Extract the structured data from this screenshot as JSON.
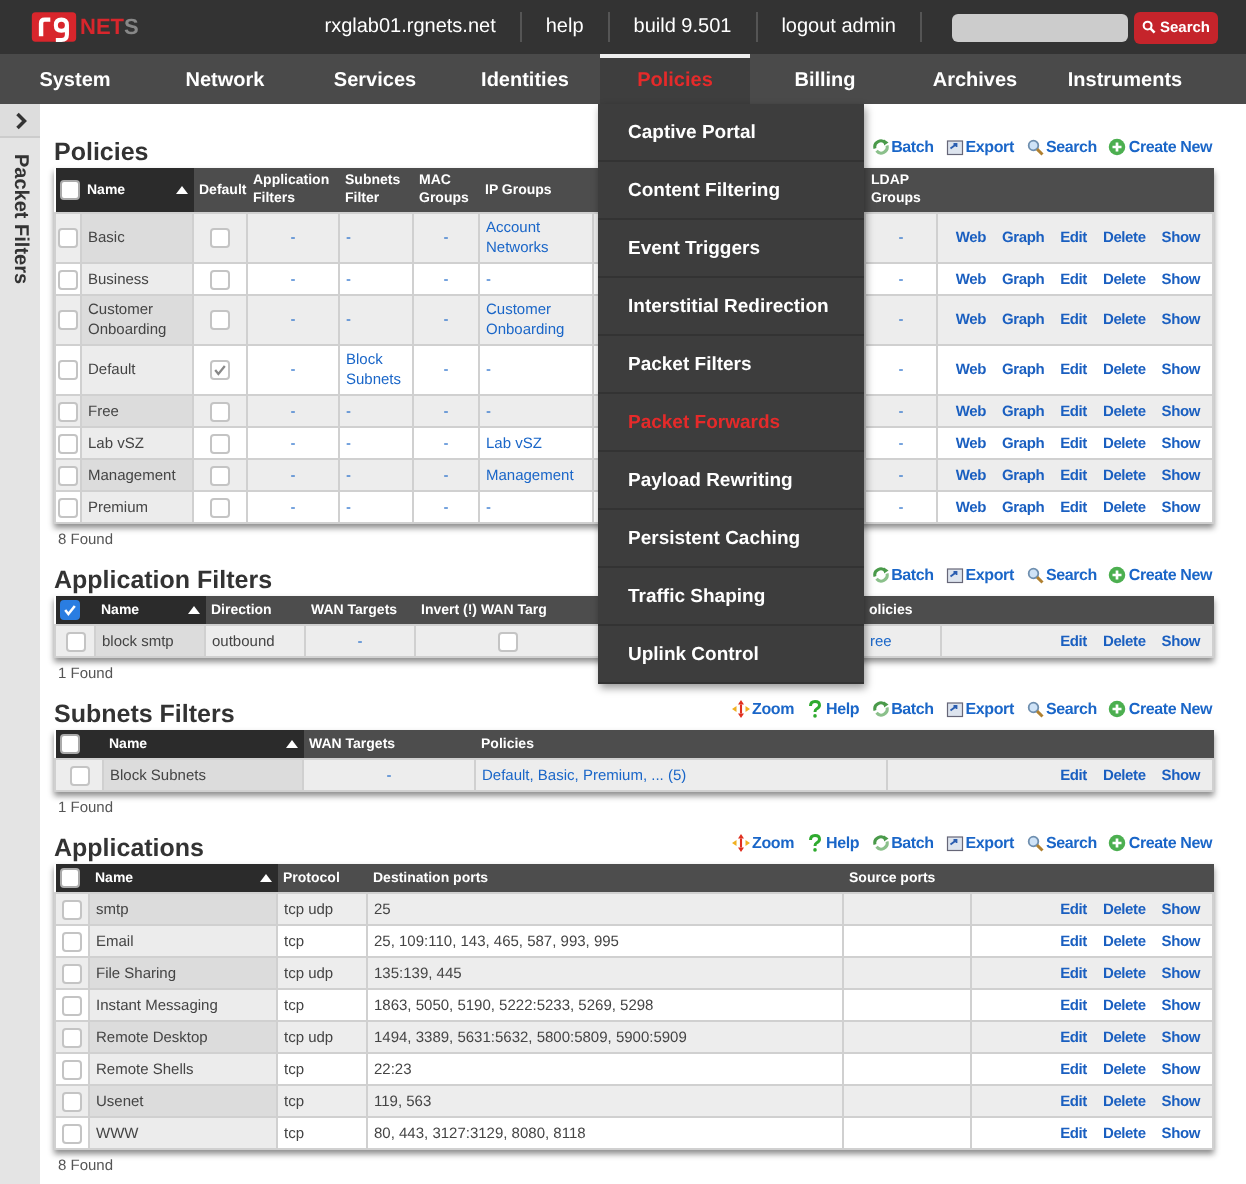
{
  "header": {
    "logo_text": "NET",
    "logo_tail": "S",
    "links": [
      "rxglab01.rgnets.net",
      "help",
      "build 9.501",
      "logout admin"
    ],
    "search_button": "Search"
  },
  "nav": [
    {
      "label": "System",
      "selected": false
    },
    {
      "label": "Network",
      "selected": false
    },
    {
      "label": "Services",
      "selected": false
    },
    {
      "label": "Identities",
      "selected": false
    },
    {
      "label": "Policies",
      "selected": true
    },
    {
      "label": "Billing",
      "selected": false
    },
    {
      "label": "Archives",
      "selected": false
    },
    {
      "label": "Instruments",
      "selected": false
    }
  ],
  "menu": [
    {
      "label": "Captive Portal",
      "selected": false
    },
    {
      "label": "Content Filtering",
      "selected": false
    },
    {
      "label": "Event Triggers",
      "selected": false
    },
    {
      "label": "Interstitial Redirection",
      "selected": false
    },
    {
      "label": "Packet Filters",
      "selected": false
    },
    {
      "label": "Packet Forwards",
      "selected": true
    },
    {
      "label": "Payload Rewriting",
      "selected": false
    },
    {
      "label": "Persistent Caching",
      "selected": false
    },
    {
      "label": "Traffic Shaping",
      "selected": false
    },
    {
      "label": "Uplink Control",
      "selected": false
    }
  ],
  "sidebar": {
    "label": "Packet Filters"
  },
  "sections": [
    {
      "title": "Policies",
      "toolbar": [
        {
          "kind": "batch",
          "label": "Batch"
        },
        {
          "kind": "export",
          "label": "Export"
        },
        {
          "kind": "search",
          "label": "Search"
        },
        {
          "kind": "create",
          "label": "Create New"
        }
      ],
      "all_checked": false,
      "columns": [
        {
          "label": "Name",
          "kind": "name",
          "sorted": true
        },
        {
          "label": "Default",
          "kind": "check"
        },
        {
          "label": "Application Filters",
          "kind": "ref"
        },
        {
          "label": "Subnets Filter",
          "kind": "link"
        },
        {
          "label": "MAC Groups",
          "kind": "ref"
        },
        {
          "label": "IP Groups",
          "kind": "link"
        },
        {
          "kind": "covered"
        },
        {
          "label": "LDAP Groups",
          "kind": "ref"
        }
      ],
      "rows": [
        {
          "checked": false,
          "cells": [
            "Basic",
            false,
            "-",
            "-",
            "-",
            "Account Networks",
            "-"
          ],
          "actions": [
            "Web",
            "Graph",
            "Edit",
            "Delete",
            "Show"
          ]
        },
        {
          "checked": false,
          "cells": [
            "Business",
            false,
            "-",
            "-",
            "-",
            "-",
            "-"
          ],
          "actions": [
            "Web",
            "Graph",
            "Edit",
            "Delete",
            "Show"
          ]
        },
        {
          "checked": false,
          "cells": [
            "Customer Onboarding",
            false,
            "-",
            "-",
            "-",
            "Customer Onboarding",
            "-"
          ],
          "actions": [
            "Web",
            "Graph",
            "Edit",
            "Delete",
            "Show"
          ]
        },
        {
          "checked": false,
          "cells": [
            "Default",
            true,
            "-",
            "Block Subnets",
            "-",
            "-",
            "-"
          ],
          "actions": [
            "Web",
            "Graph",
            "Edit",
            "Delete",
            "Show"
          ]
        },
        {
          "checked": false,
          "cells": [
            "Free",
            false,
            "-",
            "-",
            "-",
            "-",
            "-"
          ],
          "actions": [
            "Web",
            "Graph",
            "Edit",
            "Delete",
            "Show"
          ]
        },
        {
          "checked": false,
          "cells": [
            "Lab vSZ",
            false,
            "-",
            "-",
            "-",
            "Lab vSZ",
            "-"
          ],
          "actions": [
            "Web",
            "Graph",
            "Edit",
            "Delete",
            "Show"
          ]
        },
        {
          "checked": false,
          "cells": [
            "Management",
            false,
            "-",
            "-",
            "-",
            "Management",
            "-"
          ],
          "actions": [
            "Web",
            "Graph",
            "Edit",
            "Delete",
            "Show"
          ]
        },
        {
          "checked": false,
          "cells": [
            "Premium",
            false,
            "-",
            "-",
            "-",
            "-",
            "-"
          ],
          "actions": [
            "Web",
            "Graph",
            "Edit",
            "Delete",
            "Show"
          ]
        }
      ],
      "found": "8 Found"
    },
    {
      "title": "Application Filters",
      "toolbar": [
        {
          "kind": "batch",
          "label": "Batch"
        },
        {
          "kind": "export",
          "label": "Export"
        },
        {
          "kind": "search",
          "label": "Search"
        },
        {
          "kind": "create",
          "label": "Create New"
        }
      ],
      "all_checked": true,
      "columns": [
        {
          "label": "Name",
          "kind": "name",
          "sorted": true
        },
        {
          "label": "Direction",
          "kind": "text"
        },
        {
          "label": "WAN Targets",
          "kind": "ref"
        },
        {
          "label": "Invert (!) WAN Targ",
          "kind": "check"
        },
        {
          "kind": "covered"
        },
        {
          "label": "olicies",
          "kind": "link"
        }
      ],
      "rows": [
        {
          "checked": false,
          "cells": [
            "block smtp",
            "outbound",
            "-",
            false,
            "ree"
          ],
          "actions": [
            "Edit",
            "Delete",
            "Show"
          ]
        }
      ],
      "found": "1 Found"
    },
    {
      "title": "Subnets Filters",
      "toolbar": [
        {
          "kind": "zoom",
          "label": "Zoom"
        },
        {
          "kind": "help",
          "label": "Help"
        },
        {
          "kind": "batch",
          "label": "Batch"
        },
        {
          "kind": "export",
          "label": "Export"
        },
        {
          "kind": "search",
          "label": "Search"
        },
        {
          "kind": "create",
          "label": "Create New"
        }
      ],
      "all_checked": false,
      "columns": [
        {
          "label": "Name",
          "kind": "name",
          "sorted": true
        },
        {
          "label": "WAN Targets",
          "kind": "ref"
        },
        {
          "label": "Policies",
          "kind": "link"
        }
      ],
      "rows": [
        {
          "checked": false,
          "cells": [
            "Block Subnets",
            "-",
            "Default, Basic, Premium, ... (5)"
          ],
          "actions": [
            "Edit",
            "Delete",
            "Show"
          ]
        }
      ],
      "found": "1 Found"
    },
    {
      "title": "Applications",
      "toolbar": [
        {
          "kind": "zoom",
          "label": "Zoom"
        },
        {
          "kind": "help",
          "label": "Help"
        },
        {
          "kind": "batch",
          "label": "Batch"
        },
        {
          "kind": "export",
          "label": "Export"
        },
        {
          "kind": "search",
          "label": "Search"
        },
        {
          "kind": "create",
          "label": "Create New"
        }
      ],
      "all_checked": false,
      "columns": [
        {
          "label": "Name",
          "kind": "name",
          "sorted": true
        },
        {
          "label": "Protocol",
          "kind": "text"
        },
        {
          "label": "Destination ports",
          "kind": "text"
        },
        {
          "label": "Source ports",
          "kind": "text"
        }
      ],
      "rows": [
        {
          "checked": false,
          "cells": [
            "smtp",
            "tcp udp",
            "25"
          ],
          "actions": [
            "Edit",
            "Delete",
            "Show"
          ]
        },
        {
          "checked": false,
          "cells": [
            "Email",
            "tcp",
            "25, 109:110, 143, 465, 587, 993, 995"
          ],
          "actions": [
            "Edit",
            "Delete",
            "Show"
          ]
        },
        {
          "checked": false,
          "cells": [
            "File Sharing",
            "tcp udp",
            "135:139, 445"
          ],
          "actions": [
            "Edit",
            "Delete",
            "Show"
          ]
        },
        {
          "checked": false,
          "cells": [
            "Instant Messaging",
            "tcp",
            "1863, 5050, 5190, 5222:5233, 5269, 5298"
          ],
          "actions": [
            "Edit",
            "Delete",
            "Show"
          ]
        },
        {
          "checked": false,
          "cells": [
            "Remote Desktop",
            "tcp udp",
            "1494, 3389, 5631:5632, 5800:5809, 5900:5909"
          ],
          "actions": [
            "Edit",
            "Delete",
            "Show"
          ]
        },
        {
          "checked": false,
          "cells": [
            "Remote Shells",
            "tcp",
            "22:23"
          ],
          "actions": [
            "Edit",
            "Delete",
            "Show"
          ]
        },
        {
          "checked": false,
          "cells": [
            "Usenet",
            "tcp",
            "119, 563"
          ],
          "actions": [
            "Edit",
            "Delete",
            "Show"
          ]
        },
        {
          "checked": false,
          "cells": [
            "WWW",
            "tcp",
            "80, 443, 3127:3129, 8080, 8118"
          ],
          "actions": [
            "Edit",
            "Delete",
            "Show"
          ]
        }
      ],
      "found": "8 Found"
    }
  ]
}
